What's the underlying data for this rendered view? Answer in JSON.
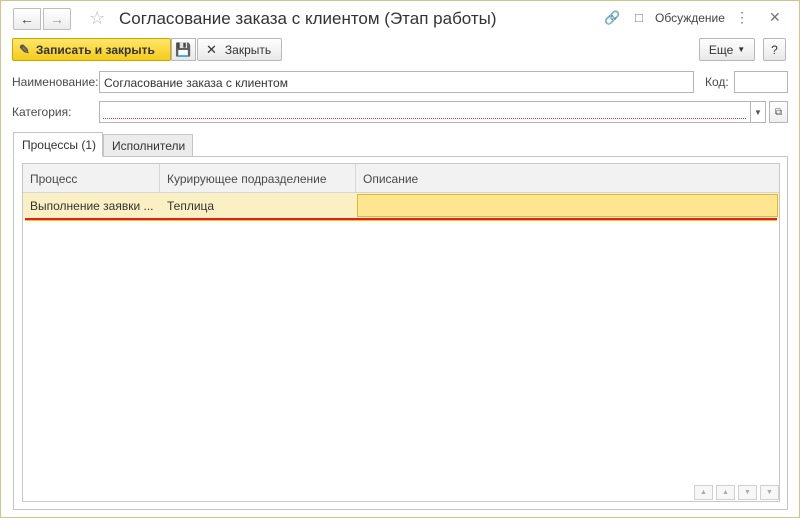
{
  "window": {
    "title": "Согласование заказа с клиентом (Этап работы)",
    "discussion_label": "Обсуждение"
  },
  "toolbar": {
    "save_close_label": "Записать и закрыть",
    "close_label": "Закрыть",
    "more_label": "Еще",
    "help_label": "?"
  },
  "form": {
    "name_label": "Наименование:",
    "name_value": "Согласование заказа с клиентом",
    "code_label": "Код:",
    "code_value": "",
    "category_label": "Категория:",
    "category_value": ""
  },
  "tabs": [
    {
      "label": "Процессы (1)",
      "active": true
    },
    {
      "label": "Исполнители",
      "active": false
    }
  ],
  "table": {
    "columns": [
      "Процесс",
      "Курирующее подразделение",
      "Описание"
    ],
    "rows": [
      [
        "Выполнение заявки ...",
        "Теплица",
        ""
      ]
    ]
  },
  "colors": {
    "primary_button": "#f5cc1a",
    "selected_row": "#fbf0c3",
    "active_cell": "#fde68f",
    "error_underline": "#e02020"
  }
}
